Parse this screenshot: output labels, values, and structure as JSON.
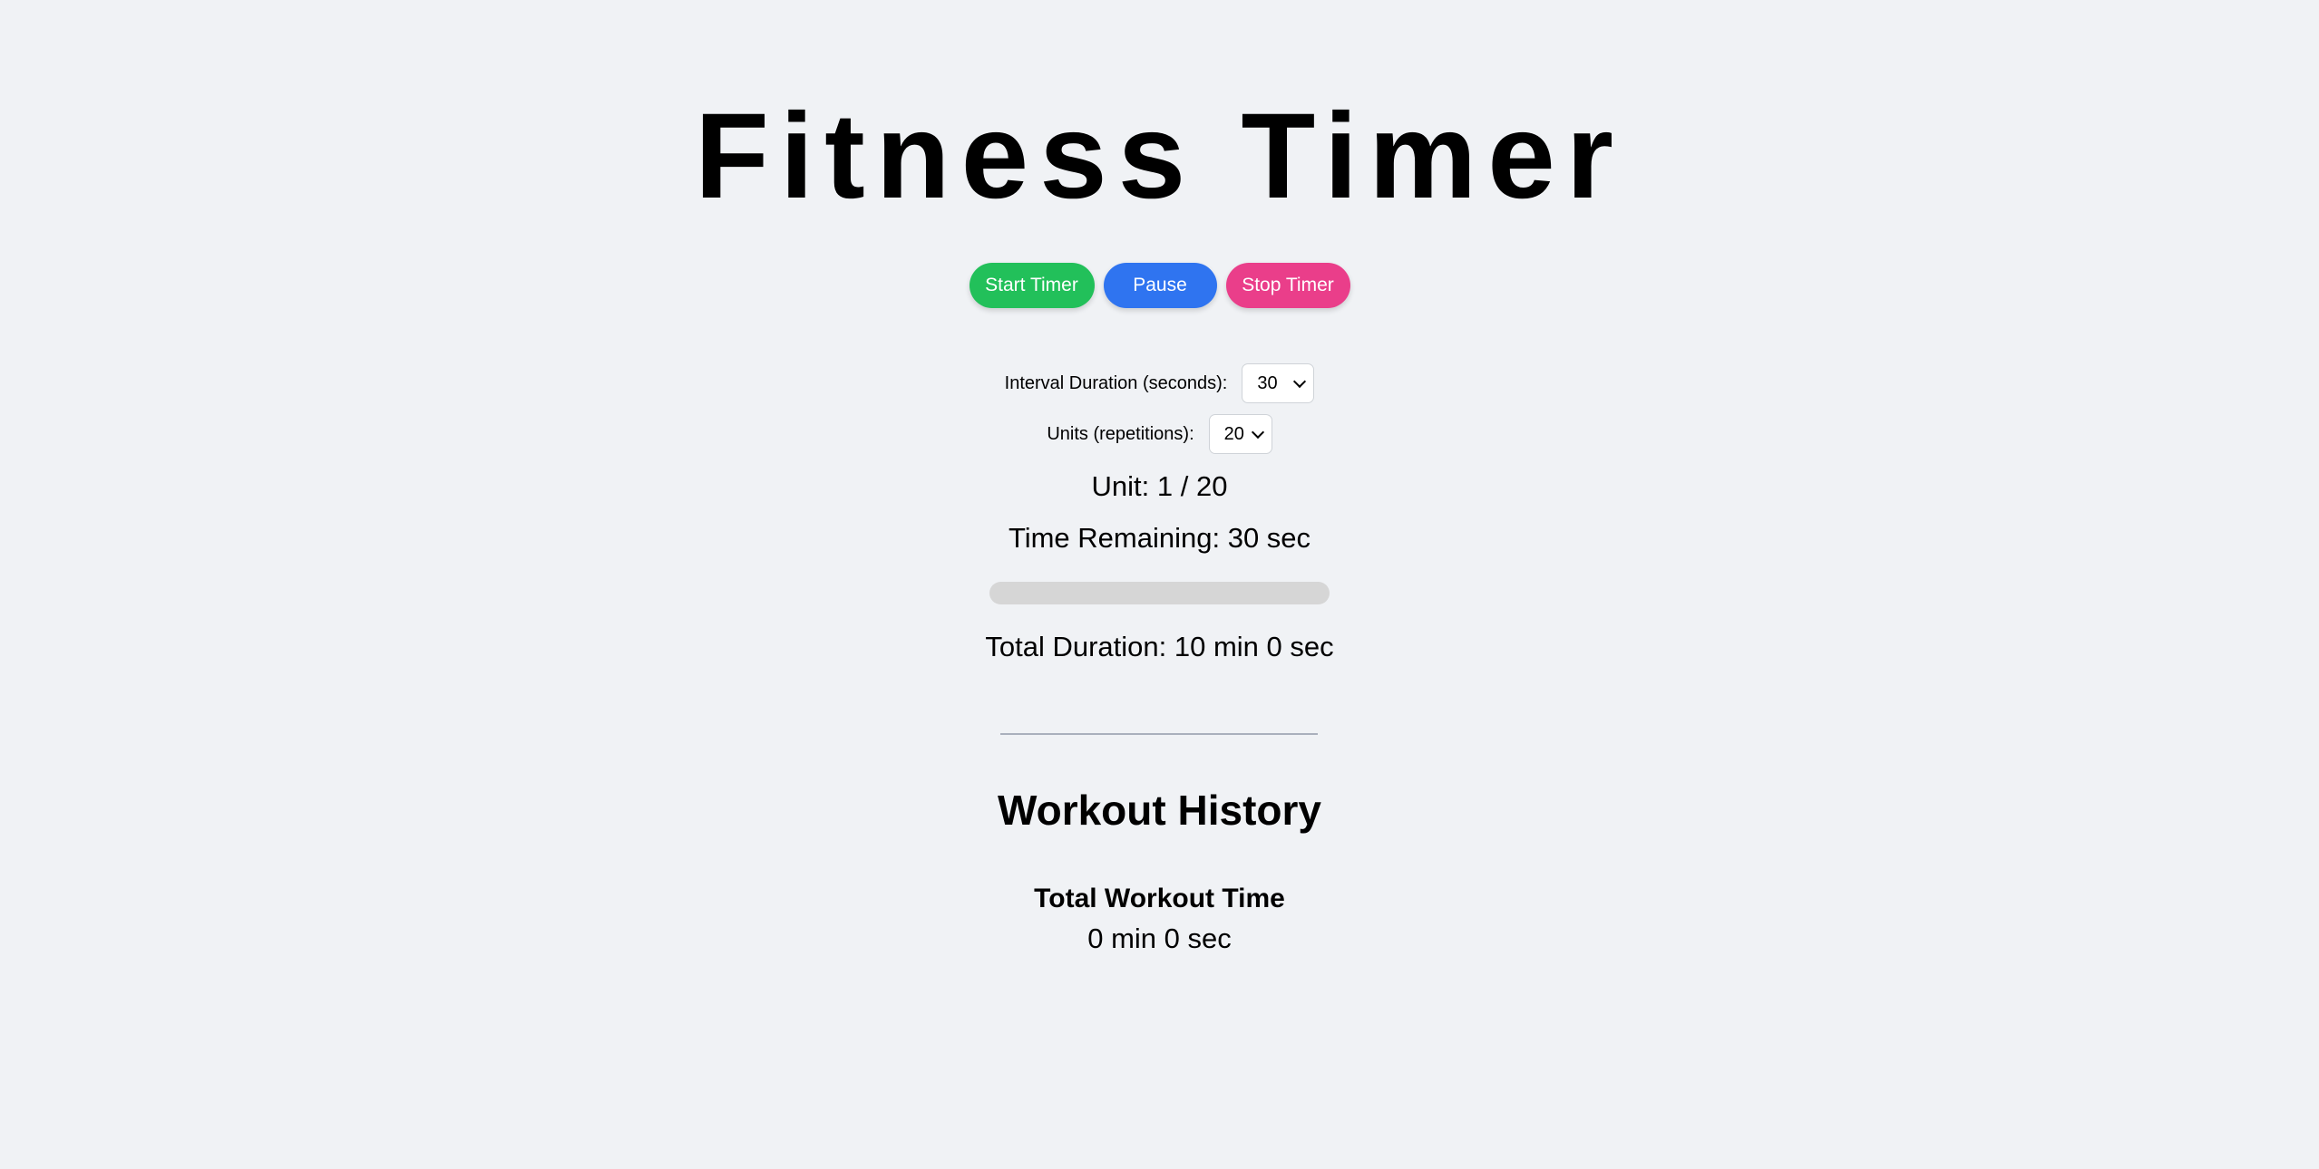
{
  "app": {
    "title": "Fitness Timer"
  },
  "controls": {
    "start_label": "Start Timer",
    "pause_label": "Pause",
    "stop_label": "Stop Timer"
  },
  "settings": {
    "interval_label": "Interval Duration (seconds):",
    "interval_value": "30",
    "units_label": "Units (repetitions):",
    "units_value": "20"
  },
  "status": {
    "unit_text": "Unit: 1 / 20",
    "time_remaining_text": "Time Remaining: 30 sec",
    "progress_fraction": 0,
    "total_duration_text": "Total Duration: 10 min 0 sec"
  },
  "history": {
    "title": "Workout History",
    "total_label": "Total Workout Time",
    "total_value": "0 min 0 sec"
  },
  "colors": {
    "background": "#f0f2f5",
    "start_button": "#22c05a",
    "pause_button": "#2f74f0",
    "stop_button": "#ea3e8a",
    "progress_track": "#d6d6d6"
  },
  "icons": {
    "select_arrow": "chevron-down-icon"
  }
}
